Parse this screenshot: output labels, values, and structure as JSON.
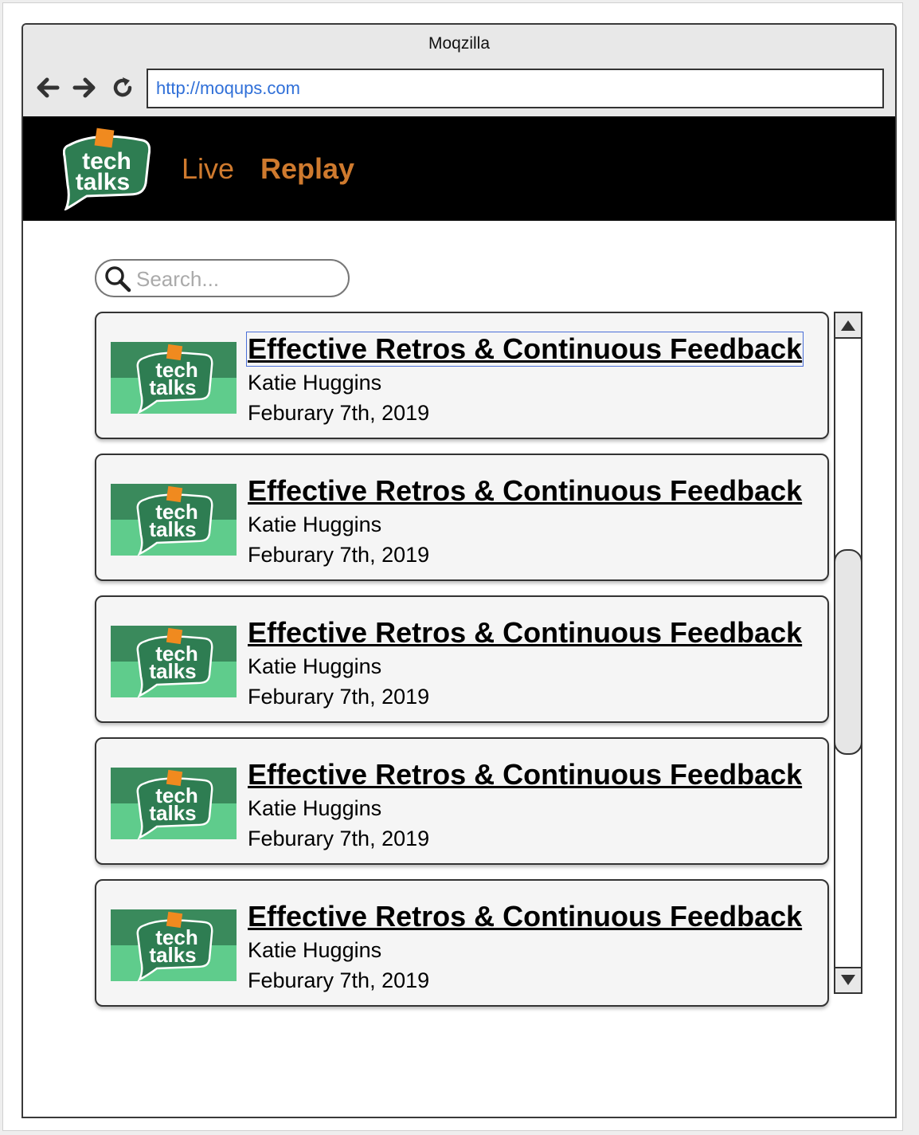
{
  "window": {
    "title": "Moqzilla"
  },
  "browser": {
    "url": "http://moqups.com",
    "back_icon": "arrow-left-icon",
    "forward_icon": "arrow-right-icon",
    "reload_icon": "reload-icon"
  },
  "header": {
    "logo_line1": "tech",
    "logo_line2": "talks",
    "nav": [
      {
        "label": "Live",
        "active": false
      },
      {
        "label": "Replay",
        "active": true
      }
    ]
  },
  "search": {
    "placeholder": "Search...",
    "icon": "search-icon"
  },
  "talks": [
    {
      "title": "Effective Retros & Continuous Feedback",
      "speaker": "Katie Huggins",
      "date": "Feburary 7th, 2019"
    },
    {
      "title": "Effective Retros & Continuous Feedback",
      "speaker": "Katie Huggins",
      "date": "Feburary 7th, 2019"
    },
    {
      "title": "Effective Retros & Continuous Feedback",
      "speaker": "Katie Huggins",
      "date": "Feburary 7th, 2019"
    },
    {
      "title": "Effective Retros & Continuous Feedback",
      "speaker": "Katie Huggins",
      "date": "Feburary 7th, 2019"
    },
    {
      "title": "Effective Retros & Continuous Feedback",
      "speaker": "Katie Huggins",
      "date": "Feburary 7th, 2019"
    }
  ],
  "colors": {
    "nav_link": "#cf7a2e",
    "header_bg": "#000000",
    "logo_green": "#2e7d52",
    "thumb_dark": "#3a8a5c",
    "thumb_light": "#5fcc8c",
    "url_text": "#2f6fd8"
  }
}
